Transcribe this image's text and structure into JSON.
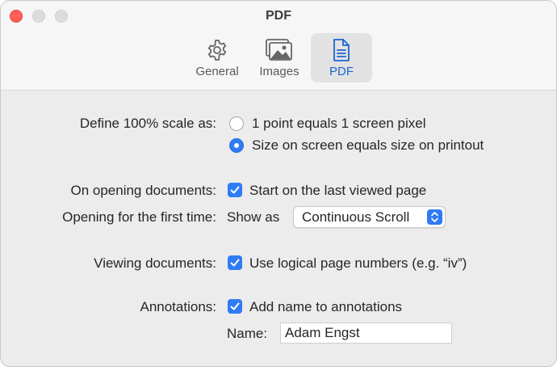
{
  "window": {
    "title": "PDF"
  },
  "tabs": [
    {
      "label": "General",
      "icon": "gear-icon"
    },
    {
      "label": "Images",
      "icon": "photos-icon"
    },
    {
      "label": "PDF",
      "icon": "document-icon",
      "active": true
    }
  ],
  "colors": {
    "accent": "#2f7bf5",
    "active_tab_text": "#1c64d6"
  },
  "scale": {
    "label": "Define 100% scale as:",
    "options": [
      {
        "text": "1 point equals 1 screen pixel",
        "selected": false
      },
      {
        "text": "Size on screen equals size on printout",
        "selected": true
      }
    ]
  },
  "opening": {
    "label": "On opening documents:",
    "checkbox_text": "Start on the last viewed page",
    "checked": true
  },
  "first_time": {
    "label": "Opening for the first time:",
    "prefix": "Show as",
    "selected_value": "Continuous Scroll"
  },
  "viewing": {
    "label": "Viewing documents:",
    "checkbox_text": "Use logical page numbers (e.g. “iv”)",
    "checked": true
  },
  "annotations": {
    "label": "Annotations:",
    "checkbox_text": "Add name to annotations",
    "checked": true,
    "name_label": "Name:",
    "name_value": "Adam Engst"
  }
}
